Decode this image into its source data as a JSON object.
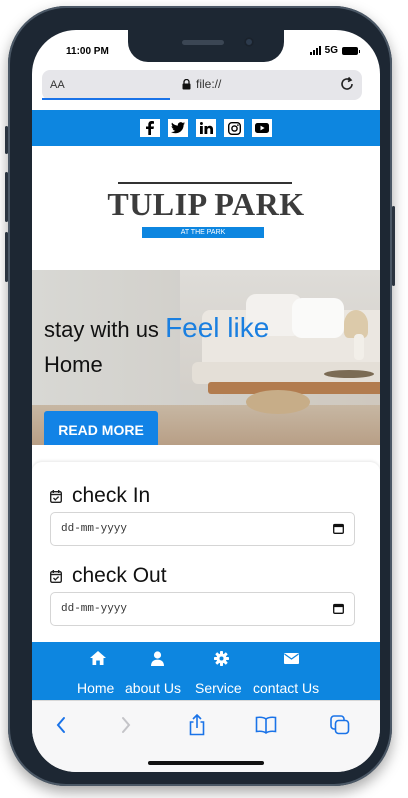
{
  "status_bar": {
    "time": "11:00 PM",
    "network": "5G"
  },
  "browser": {
    "text_size_label": "AA",
    "url": "file://"
  },
  "social_icons": [
    "facebook-icon",
    "twitter-icon",
    "linkedin-icon",
    "instagram-icon",
    "youtube-icon"
  ],
  "logo": {
    "name": "TULIP PARK",
    "tagline": "AT THE PARK"
  },
  "hero": {
    "line1": "stay with us",
    "highlight": "Feel like",
    "line2": "Home",
    "button_label": "READ MORE"
  },
  "booking": {
    "check_in_label": "check In",
    "check_in_placeholder": "dd-mm-yyyy",
    "check_out_label": "check Out",
    "check_out_placeholder": "dd-mm-yyyy"
  },
  "footer_nav": [
    {
      "label": "Home",
      "icon": "home-icon"
    },
    {
      "label": "about Us",
      "icon": "user-icon"
    },
    {
      "label": "Service",
      "icon": "gear-icon"
    },
    {
      "label": "contact Us",
      "icon": "envelope-icon"
    }
  ],
  "colors": {
    "brand_blue": "#0d86e0",
    "button_blue": "#1283e6",
    "highlight_blue": "#1a7fe0"
  }
}
